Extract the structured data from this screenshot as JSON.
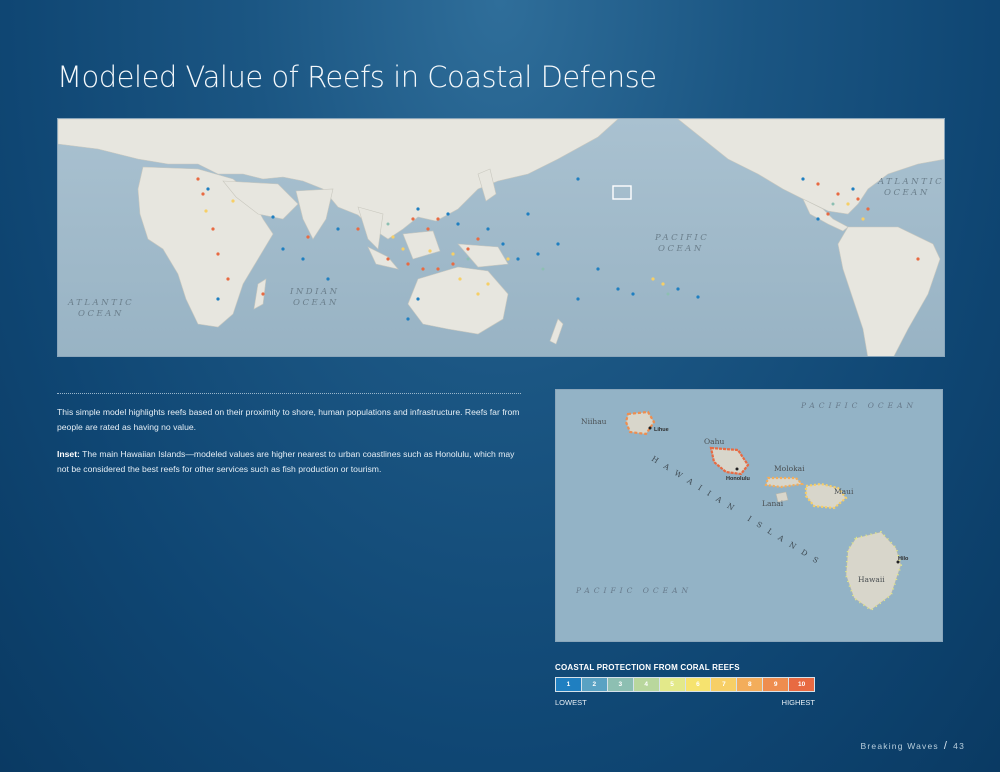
{
  "page": {
    "title": "Modeled Value of Reefs in Coastal Defense",
    "footer_publication": "Breaking Waves",
    "footer_page_number": "43"
  },
  "world_map": {
    "ocean_labels": [
      "ATLANTIC",
      "OCEAN",
      "INDIAN",
      "OCEAN",
      "PACIFIC",
      "OCEAN",
      "ATLANTIC",
      "OCEAN"
    ]
  },
  "text": {
    "description": "This simple model highlights reefs based on their proximity to shore, human populations and infrastructure. Reefs far from people are rated as having no value.",
    "inset_label": "Inset:",
    "inset_body": " The main Hawaiian Islands—modeled values are higher nearest to urban coastlines such as Honolulu, which may not be considered the best reefs for other services such as fish production or tourism."
  },
  "inset_map": {
    "ocean_top": "PACIFIC OCEAN",
    "ocean_bottom": "PACIFIC OCEAN",
    "chain_label": "HAWAIIAN ISLANDS",
    "islands": [
      "Niihau",
      "Oahu",
      "Molokai",
      "Lanai",
      "Maui",
      "Hawaii"
    ],
    "towns": [
      "Lihue",
      "Honolulu",
      "Hilo"
    ]
  },
  "legend": {
    "title": "COASTAL PROTECTION FROM CORAL REEFS",
    "low_label": "LOWEST",
    "high_label": "HIGHEST",
    "classes": [
      {
        "value": "1",
        "color": "#1f7fc1"
      },
      {
        "value": "2",
        "color": "#5aa2c3"
      },
      {
        "value": "3",
        "color": "#8dbfb2"
      },
      {
        "value": "4",
        "color": "#b9d79d"
      },
      {
        "value": "5",
        "color": "#e3e98a"
      },
      {
        "value": "6",
        "color": "#f6e36f"
      },
      {
        "value": "7",
        "color": "#f7cf66"
      },
      {
        "value": "8",
        "color": "#f3ad5b"
      },
      {
        "value": "9",
        "color": "#ee8d4f"
      },
      {
        "value": "10",
        "color": "#e86a42"
      }
    ]
  }
}
